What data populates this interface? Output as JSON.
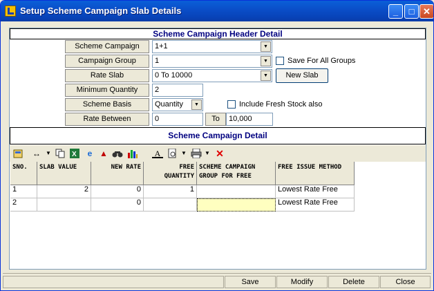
{
  "window": {
    "title": "Setup Scheme Campaign Slab Details"
  },
  "header_section": {
    "title": "Scheme Campaign Header Detail"
  },
  "form": {
    "scheme_campaign": {
      "label": "Scheme Campaign",
      "value": "1+1"
    },
    "campaign_group": {
      "label": "Campaign Group",
      "value": "1"
    },
    "save_for_all_groups": {
      "label": "Save For All Groups",
      "checked": false
    },
    "rate_slab": {
      "label": "Rate Slab",
      "value": "0 To 10000"
    },
    "new_slab_button": "New Slab",
    "minimum_quantity": {
      "label": "Minimum Quantity",
      "value": "2"
    },
    "scheme_basis": {
      "label": "Scheme Basis",
      "value": "Quantity"
    },
    "include_fresh_stock": {
      "label": "Include Fresh Stock also",
      "checked": false
    },
    "rate_between": {
      "label": "Rate Between",
      "from": "0",
      "to_label": "To",
      "to": "10,000"
    }
  },
  "detail_section": {
    "title": "Scheme Campaign Detail"
  },
  "toolbar": {
    "icons": [
      "save-layout-icon",
      "column-width-icon",
      "copy-icon",
      "excel-icon",
      "internet-explorer-icon",
      "move-up-icon",
      "find-icon",
      "chart-icon",
      "font-icon",
      "print-preview-icon",
      "print-icon",
      "delete-icon"
    ]
  },
  "grid": {
    "columns": [
      "SNO.",
      "SLAB VALUE",
      "NEW RATE",
      "FREE QUANTITY",
      "SCHEME CAMPAIGN GROUP FOR FREE",
      "FREE ISSUE METHOD"
    ],
    "rows": [
      {
        "sno": "1",
        "slab_value": "2",
        "new_rate": "0",
        "free_quantity": "1",
        "group_for_free": "",
        "method": "Lowest Rate Free"
      },
      {
        "sno": "2",
        "slab_value": "",
        "new_rate": "0",
        "free_quantity": "",
        "group_for_free": "",
        "method": "Lowest Rate Free"
      }
    ],
    "active_cell_color": "#ffffc0"
  },
  "actions": {
    "save": "Save",
    "modify": "Modify",
    "delete": "Delete",
    "close": "Close"
  }
}
